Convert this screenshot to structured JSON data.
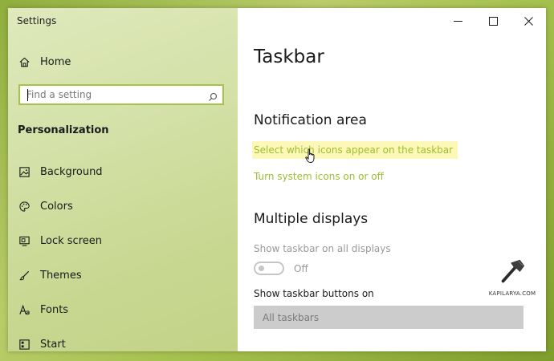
{
  "window": {
    "title": "Settings"
  },
  "sidebar": {
    "home_label": "Home",
    "search_placeholder": "Find a setting",
    "section_label": "Personalization",
    "items": [
      {
        "label": "Background",
        "icon": "picture-icon"
      },
      {
        "label": "Colors",
        "icon": "palette-icon"
      },
      {
        "label": "Lock screen",
        "icon": "monitor-icon"
      },
      {
        "label": "Themes",
        "icon": "brush-icon"
      },
      {
        "label": "Fonts",
        "icon": "font-icon"
      },
      {
        "label": "Start",
        "icon": "start-icon"
      }
    ]
  },
  "main": {
    "page_title": "Taskbar",
    "notification_area": {
      "heading": "Notification area",
      "link_select_icons": "Select which icons appear on the taskbar",
      "link_system_icons": "Turn system icons on or off"
    },
    "multiple_displays": {
      "heading": "Multiple displays",
      "show_taskbar_label": "Show taskbar on all displays",
      "toggle_state": "Off",
      "buttons_on_label": "Show taskbar buttons on",
      "buttons_on_value": "All taskbars"
    }
  },
  "watermark": {
    "text": "KAPILARYA.COM"
  },
  "colors": {
    "accent_link": "#9cbe2f",
    "highlight": "#fdf8b7",
    "search_border": "#a6c349"
  }
}
